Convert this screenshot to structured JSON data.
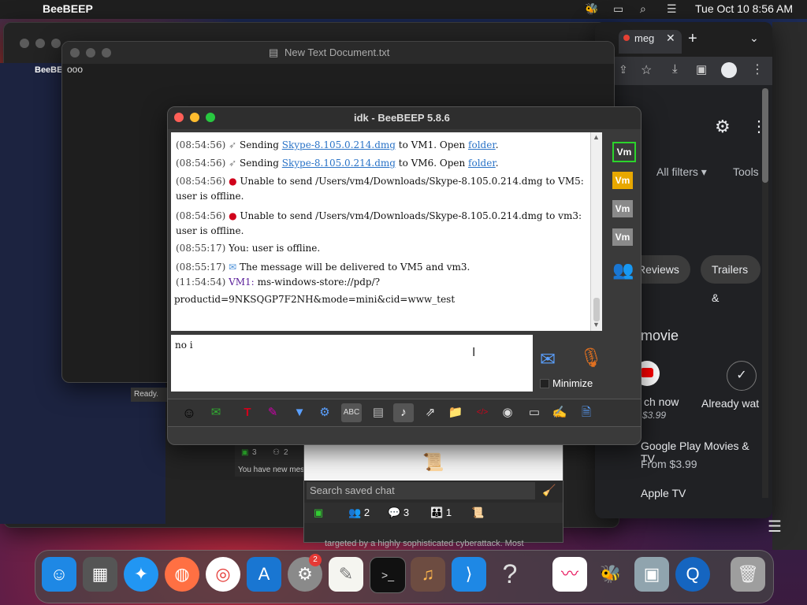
{
  "menubar": {
    "app_name": "BeeBEEP",
    "clock": "Tue Oct 10  8:56 AM"
  },
  "chrome": {
    "tab_label": "meg",
    "all_filters": "All filters",
    "tools": "Tools",
    "chip_reviews": "Reviews",
    "chip_trailers": "Trailers &",
    "section_title": "movie",
    "watch_now": "ch now",
    "watch_price": "$3.99",
    "already_watched": "Already wat",
    "gp_title": "Google Play Movies & TV",
    "gp_price": "From $3.99",
    "apple_tv": "Apple TV"
  },
  "textedit": {
    "title": "New Text Document.txt",
    "content": "ooo"
  },
  "inner_window": {
    "app_label": "BeeBE"
  },
  "status": {
    "ready": "Ready."
  },
  "beebeep": {
    "title": "idk - BeeBEEP 5.8.6",
    "messages": [
      {
        "ts": "(08:54:56)",
        "pre": "Sending ",
        "link": "Skype-8.105.0.214.dmg",
        "post": " to VM1. Open ",
        "link2": "folder",
        "end": "."
      },
      {
        "ts": "(08:54:56)",
        "pre": "Sending ",
        "link": "Skype-8.105.0.214.dmg",
        "post": " to VM6. Open ",
        "link2": "folder",
        "end": "."
      }
    ],
    "error1_a": "Unable to send /Users/vm4/Downloads/Skype-8.105.0.214.dmg to VM5:",
    "error1_b": "user is offline.",
    "error2_a": "Unable to send /Users/vm4/Downloads/Skype-8.105.0.214.dmg to vm3:",
    "error2_b": "user is offline.",
    "ts_err": "(08:54:56)",
    "ts_you": "(08:55:17)",
    "you_msg": "You: user is offline.",
    "ts_deliver": "(08:55:17)",
    "deliver_msg": "The message will be delivered to VM5 and vm3.",
    "ts_vm1": "(11:54:54)",
    "vm1_user": "VM1:",
    "vm1_msg_a": "ms-windows-store://pdp/?",
    "vm1_msg_b": "productid=9NKSQGP7F2NH&mode=mini&cid=www_test",
    "input_text": "no i",
    "minimize_label": "Minimize",
    "users": [
      {
        "label": "Vm",
        "color": "#5a1a8c"
      },
      {
        "label": "Vm",
        "color": "#e8a800"
      },
      {
        "label": "Vm",
        "color": "#8a8a8a"
      },
      {
        "label": "Vm",
        "color": "#8a8a8a"
      }
    ]
  },
  "notification": {
    "count_a": "3",
    "count_b": "2",
    "text": "You have new mes"
  },
  "saved_chat": {
    "search_placeholder": "Search saved chat",
    "tab_users": "2",
    "tab_chats": "3",
    "tab_groups": "1",
    "bottom_text": "targeted by a highly sophisticated cyberattack. Most"
  },
  "dock": {
    "badge": "2"
  }
}
